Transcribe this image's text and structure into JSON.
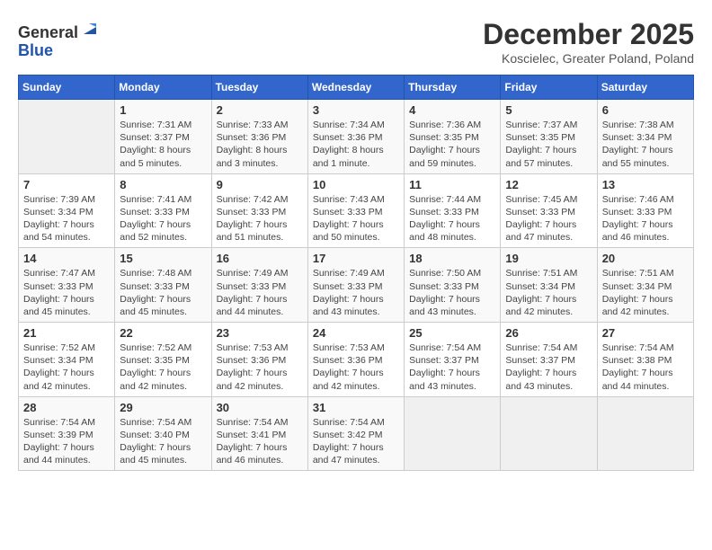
{
  "header": {
    "logo_line1": "General",
    "logo_line2": "Blue",
    "month_title": "December 2025",
    "location": "Koscielec, Greater Poland, Poland"
  },
  "weekdays": [
    "Sunday",
    "Monday",
    "Tuesday",
    "Wednesday",
    "Thursday",
    "Friday",
    "Saturday"
  ],
  "weeks": [
    [
      {
        "day": "",
        "info": ""
      },
      {
        "day": "1",
        "info": "Sunrise: 7:31 AM\nSunset: 3:37 PM\nDaylight: 8 hours\nand 5 minutes."
      },
      {
        "day": "2",
        "info": "Sunrise: 7:33 AM\nSunset: 3:36 PM\nDaylight: 8 hours\nand 3 minutes."
      },
      {
        "day": "3",
        "info": "Sunrise: 7:34 AM\nSunset: 3:36 PM\nDaylight: 8 hours\nand 1 minute."
      },
      {
        "day": "4",
        "info": "Sunrise: 7:36 AM\nSunset: 3:35 PM\nDaylight: 7 hours\nand 59 minutes."
      },
      {
        "day": "5",
        "info": "Sunrise: 7:37 AM\nSunset: 3:35 PM\nDaylight: 7 hours\nand 57 minutes."
      },
      {
        "day": "6",
        "info": "Sunrise: 7:38 AM\nSunset: 3:34 PM\nDaylight: 7 hours\nand 55 minutes."
      }
    ],
    [
      {
        "day": "7",
        "info": "Sunrise: 7:39 AM\nSunset: 3:34 PM\nDaylight: 7 hours\nand 54 minutes."
      },
      {
        "day": "8",
        "info": "Sunrise: 7:41 AM\nSunset: 3:33 PM\nDaylight: 7 hours\nand 52 minutes."
      },
      {
        "day": "9",
        "info": "Sunrise: 7:42 AM\nSunset: 3:33 PM\nDaylight: 7 hours\nand 51 minutes."
      },
      {
        "day": "10",
        "info": "Sunrise: 7:43 AM\nSunset: 3:33 PM\nDaylight: 7 hours\nand 50 minutes."
      },
      {
        "day": "11",
        "info": "Sunrise: 7:44 AM\nSunset: 3:33 PM\nDaylight: 7 hours\nand 48 minutes."
      },
      {
        "day": "12",
        "info": "Sunrise: 7:45 AM\nSunset: 3:33 PM\nDaylight: 7 hours\nand 47 minutes."
      },
      {
        "day": "13",
        "info": "Sunrise: 7:46 AM\nSunset: 3:33 PM\nDaylight: 7 hours\nand 46 minutes."
      }
    ],
    [
      {
        "day": "14",
        "info": "Sunrise: 7:47 AM\nSunset: 3:33 PM\nDaylight: 7 hours\nand 45 minutes."
      },
      {
        "day": "15",
        "info": "Sunrise: 7:48 AM\nSunset: 3:33 PM\nDaylight: 7 hours\nand 45 minutes."
      },
      {
        "day": "16",
        "info": "Sunrise: 7:49 AM\nSunset: 3:33 PM\nDaylight: 7 hours\nand 44 minutes."
      },
      {
        "day": "17",
        "info": "Sunrise: 7:49 AM\nSunset: 3:33 PM\nDaylight: 7 hours\nand 43 minutes."
      },
      {
        "day": "18",
        "info": "Sunrise: 7:50 AM\nSunset: 3:33 PM\nDaylight: 7 hours\nand 43 minutes."
      },
      {
        "day": "19",
        "info": "Sunrise: 7:51 AM\nSunset: 3:34 PM\nDaylight: 7 hours\nand 42 minutes."
      },
      {
        "day": "20",
        "info": "Sunrise: 7:51 AM\nSunset: 3:34 PM\nDaylight: 7 hours\nand 42 minutes."
      }
    ],
    [
      {
        "day": "21",
        "info": "Sunrise: 7:52 AM\nSunset: 3:34 PM\nDaylight: 7 hours\nand 42 minutes."
      },
      {
        "day": "22",
        "info": "Sunrise: 7:52 AM\nSunset: 3:35 PM\nDaylight: 7 hours\nand 42 minutes."
      },
      {
        "day": "23",
        "info": "Sunrise: 7:53 AM\nSunset: 3:36 PM\nDaylight: 7 hours\nand 42 minutes."
      },
      {
        "day": "24",
        "info": "Sunrise: 7:53 AM\nSunset: 3:36 PM\nDaylight: 7 hours\nand 42 minutes."
      },
      {
        "day": "25",
        "info": "Sunrise: 7:54 AM\nSunset: 3:37 PM\nDaylight: 7 hours\nand 43 minutes."
      },
      {
        "day": "26",
        "info": "Sunrise: 7:54 AM\nSunset: 3:37 PM\nDaylight: 7 hours\nand 43 minutes."
      },
      {
        "day": "27",
        "info": "Sunrise: 7:54 AM\nSunset: 3:38 PM\nDaylight: 7 hours\nand 44 minutes."
      }
    ],
    [
      {
        "day": "28",
        "info": "Sunrise: 7:54 AM\nSunset: 3:39 PM\nDaylight: 7 hours\nand 44 minutes."
      },
      {
        "day": "29",
        "info": "Sunrise: 7:54 AM\nSunset: 3:40 PM\nDaylight: 7 hours\nand 45 minutes."
      },
      {
        "day": "30",
        "info": "Sunrise: 7:54 AM\nSunset: 3:41 PM\nDaylight: 7 hours\nand 46 minutes."
      },
      {
        "day": "31",
        "info": "Sunrise: 7:54 AM\nSunset: 3:42 PM\nDaylight: 7 hours\nand 47 minutes."
      },
      {
        "day": "",
        "info": ""
      },
      {
        "day": "",
        "info": ""
      },
      {
        "day": "",
        "info": ""
      }
    ]
  ]
}
